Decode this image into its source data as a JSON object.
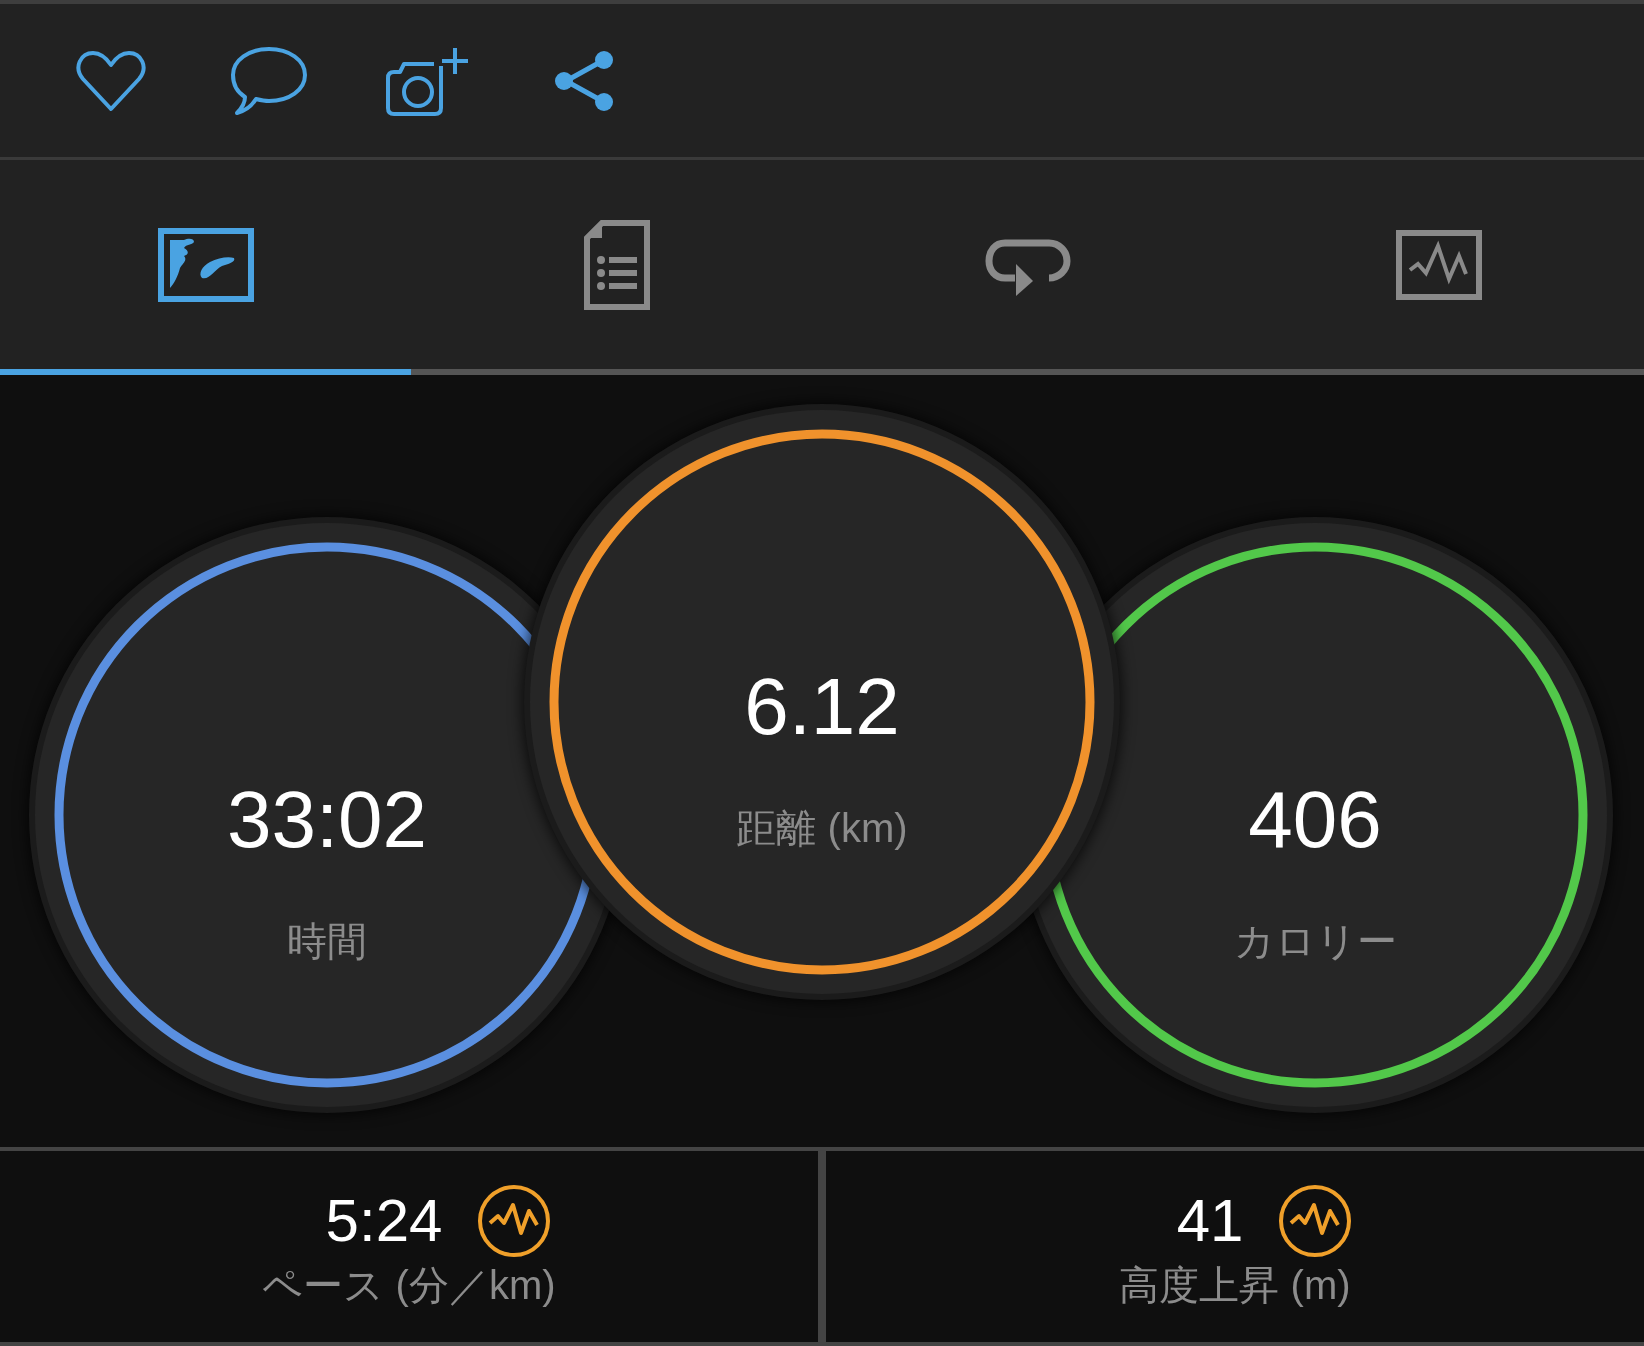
{
  "tabs": [
    {
      "kind": "map",
      "selected": true
    },
    {
      "kind": "details",
      "selected": false
    },
    {
      "kind": "laps",
      "selected": false
    },
    {
      "kind": "chart",
      "selected": false
    }
  ],
  "summary": [
    {
      "value": "33:02",
      "label": "時間",
      "color": "#5a8fe0"
    },
    {
      "value": "6.12",
      "label": "距離 (km)",
      "color": "#f0922c"
    },
    {
      "value": "406",
      "label": "カロリー",
      "color": "#52c84a"
    }
  ],
  "stats": [
    {
      "value": "5:24",
      "label": "ペース (分／km)"
    },
    {
      "value": "41",
      "label": "高度上昇 (m)"
    }
  ]
}
